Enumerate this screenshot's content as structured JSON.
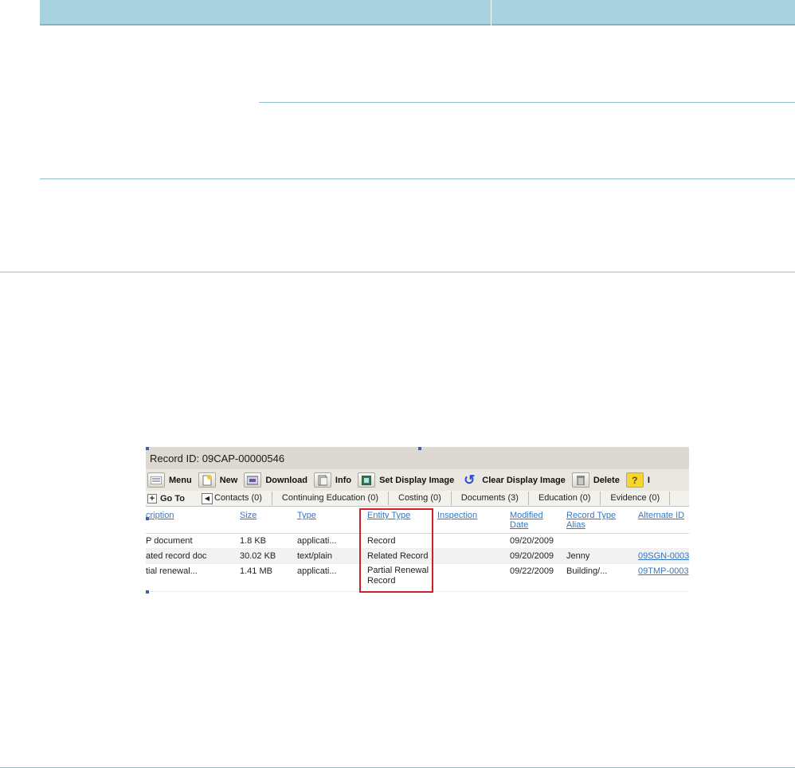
{
  "record": {
    "title": "Record ID: 09CAP-00000546"
  },
  "toolbar": {
    "buttons": [
      {
        "label": "Menu",
        "icon": "menu-icon"
      },
      {
        "label": "New",
        "icon": "new-icon"
      },
      {
        "label": "Download",
        "icon": "download-icon"
      },
      {
        "label": "Info",
        "icon": "info-icon"
      },
      {
        "label": "Set Display Image",
        "icon": "image-icon"
      },
      {
        "label": "Clear Display Image",
        "icon": "refresh-icon"
      },
      {
        "label": "Delete",
        "icon": "trash-icon"
      },
      {
        "label": "I",
        "icon": "help-icon"
      }
    ]
  },
  "tabs": {
    "goto_label": "Go To",
    "items": [
      "Contacts (0)",
      "Continuing Education (0)",
      "Costing (0)",
      "Documents (3)",
      "Education (0)",
      "Evidence (0)"
    ]
  },
  "grid": {
    "headers": {
      "description": "cription",
      "size": "Size",
      "type": "Type",
      "entity_type": "Entity Type",
      "inspection": "Inspection",
      "modified_date_1": "Modified",
      "modified_date_2": "Date",
      "record_type_alias_1": "Record Type",
      "record_type_alias_2": "Alias",
      "alternate_id": "Alternate ID"
    },
    "rows": [
      {
        "description": "P document",
        "size": "1.8 KB",
        "type": "applicati...",
        "entity_type": "Record",
        "entity_type_2": "",
        "modified": "09/20/2009",
        "alias": "",
        "alternate_id": ""
      },
      {
        "description": "ated record doc",
        "size": "30.02 KB",
        "type": "text/plain",
        "entity_type": "Related Record",
        "entity_type_2": "",
        "modified": "09/20/2009",
        "alias": "Jenny",
        "alternate_id": "09SGN-0003"
      },
      {
        "description": "tial renewal...",
        "size": "1.41 MB",
        "type": "applicati...",
        "entity_type": "Partial Renewal",
        "entity_type_2": "Record",
        "modified": "09/22/2009",
        "alias": "Building/...",
        "alternate_id": "09TMP-0003"
      }
    ]
  },
  "colors": {
    "header_band": "#a8d2de",
    "rule_line": "#8fbfd0",
    "link": "#3576c0",
    "highlight": "#d0202a"
  }
}
